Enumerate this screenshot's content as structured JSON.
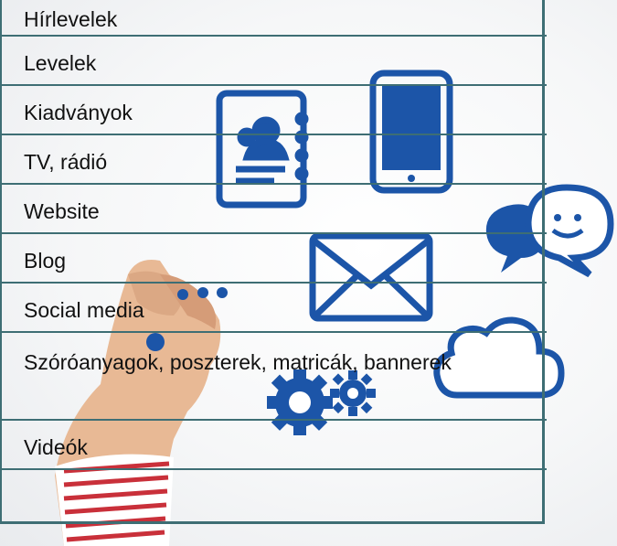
{
  "channels": [
    "Hírlevelek",
    "Levelek",
    "Kiadványok",
    "TV, rádió",
    "Website",
    "Blog",
    "Social media",
    "Szóróanyagok, poszterek, matricák, bannerek",
    "Videók"
  ],
  "icons": [
    "address-book-icon",
    "smartphone-icon",
    "chat-bubbles-icon",
    "envelope-icon",
    "cloud-icon",
    "gears-icon"
  ],
  "colors": {
    "icon_blue": "#1c55a8",
    "rule_line": "#3e6e74",
    "text": "#111111"
  }
}
